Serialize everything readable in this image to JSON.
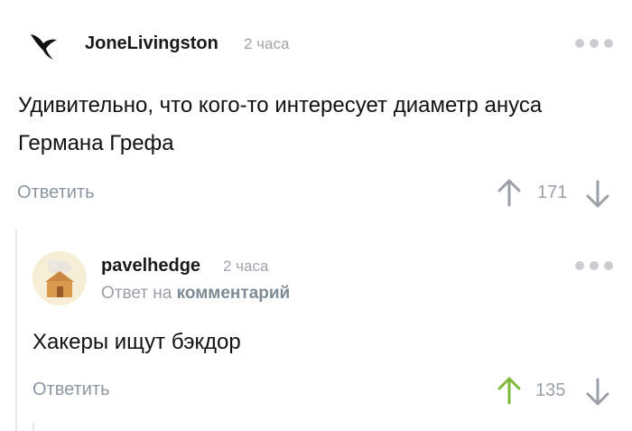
{
  "comment": {
    "username": "JoneLivingston",
    "time": "2 часа",
    "text": "Удивительно, что кого-то интересует диаметр ануса Германа Грефа",
    "reply_label": "Ответить",
    "rating": "171",
    "avatar_icon": "bird-icon"
  },
  "reply": {
    "username": "pavelhedge",
    "time": "2 часа",
    "reply_to_prefix": "Ответ на",
    "reply_to_link": "комментарий",
    "text": "Хакеры ищут бэкдор",
    "reply_label": "Ответить",
    "rating": "135",
    "avatar_icon": "house-icon",
    "upvote_color": "#7cb83a"
  },
  "colors": {
    "muted": "#9aa0a6",
    "dots": "#c9cdd2",
    "upvoted": "#7cb83a"
  }
}
